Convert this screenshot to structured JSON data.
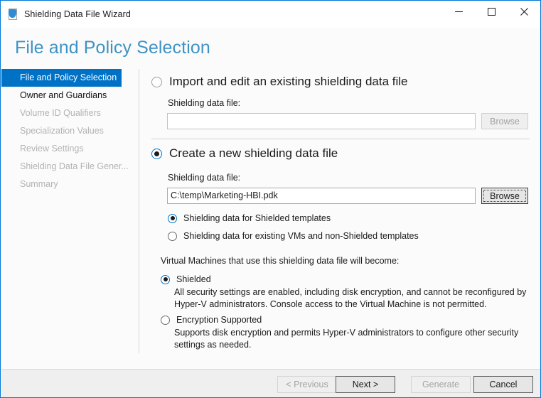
{
  "window": {
    "title": "Shielding Data File Wizard",
    "icon": "shield-document-icon",
    "accent_color": "#0078d7",
    "controls": {
      "minimize": "minimize-icon",
      "maximize": "maximize-icon",
      "close": "close-icon"
    }
  },
  "page": {
    "header": "File and Policy Selection",
    "header_color": "#3f93c4"
  },
  "sidebar": {
    "items": [
      {
        "label": "File and Policy Selection",
        "state": "selected"
      },
      {
        "label": "Owner and Guardians",
        "state": "enabled"
      },
      {
        "label": "Volume ID Qualifiers",
        "state": "disabled"
      },
      {
        "label": "Specialization Values",
        "state": "disabled"
      },
      {
        "label": "Review Settings",
        "state": "disabled"
      },
      {
        "label": "Shielding Data File Gener...",
        "state": "disabled"
      },
      {
        "label": "Summary",
        "state": "disabled"
      }
    ],
    "selected_bg": "#0072c6"
  },
  "main": {
    "import_section": {
      "radio_label": "Import and edit an existing shielding data file",
      "selected": false,
      "file_label": "Shielding data file:",
      "file_value": "",
      "browse_label": "Browse",
      "enabled": false
    },
    "create_section": {
      "radio_label": "Create a new shielding data file",
      "selected": true,
      "file_label": "Shielding data file:",
      "file_value": "C:\\temp\\Marketing-HBI.pdk",
      "browse_label": "Browse",
      "browse_focused": true,
      "type_options": [
        {
          "label": "Shielding data for Shielded templates",
          "selected": true
        },
        {
          "label": "Shielding data for existing VMs and non-Shielded templates",
          "selected": false
        }
      ]
    },
    "become_label": "Virtual Machines that use this shielding data file will become:",
    "security_options": [
      {
        "label": "Shielded",
        "selected": true,
        "description_line1": "All security settings are enabled, including disk encryption, and cannot be reconfigured by",
        "description_line2": "Hyper-V administrators. Console access to the Virtual Machine is not permitted."
      },
      {
        "label": "Encryption Supported",
        "selected": false,
        "description_line1": "Supports disk encryption and permits Hyper-V administrators to configure other security",
        "description_line2": "settings as needed."
      }
    ]
  },
  "footer": {
    "previous": {
      "label": "< Previous",
      "enabled": false
    },
    "next": {
      "label": "Next >",
      "enabled": true,
      "default": true
    },
    "generate": {
      "label": "Generate",
      "enabled": false
    },
    "cancel": {
      "label": "Cancel",
      "enabled": true
    }
  }
}
